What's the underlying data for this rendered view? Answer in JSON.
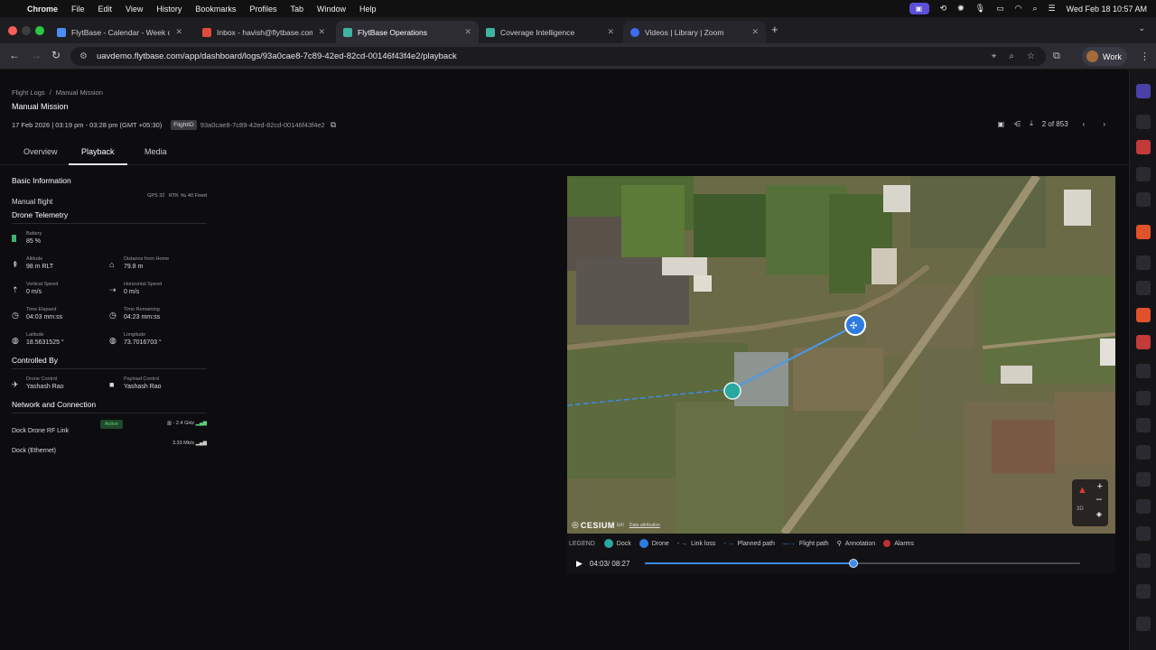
{
  "menubar": {
    "app": "Chrome",
    "items": [
      "File",
      "Edit",
      "View",
      "History",
      "Bookmarks",
      "Profiles",
      "Tab",
      "Window",
      "Help"
    ],
    "clock": "Wed Feb 18  10:57 AM"
  },
  "tabs": [
    {
      "label": "FlytBase - Calendar - Week o",
      "color": "#4a8df6"
    },
    {
      "label": "Inbox - havish@flytbase.com",
      "color": "#e04b3c"
    },
    {
      "label": "FlytBase Operations",
      "color": "#3fb3a0"
    },
    {
      "label": "Coverage Intelligence",
      "color": "#3fb3a0"
    },
    {
      "label": "Videos | Library | Zoom",
      "color": "#3c6cf0"
    }
  ],
  "address": {
    "url": "uavdemo.flytbase.com/app/dashboard/logs/93a0cae8-7c89-42ed-82cd-00146f43f4e2/playback",
    "profile": "Work"
  },
  "page": {
    "breadcrumb": [
      "Flight Logs",
      "Manual Mission"
    ],
    "title": "Manual Mission",
    "datetime": "17 Feb 2026 | 03:19 pm - 03:28 pm (GMT +05:30)",
    "flight_id_label": "FlightID",
    "flight_id": "93a0cae8-7c89-42ed-82cd-00146f43f4e2",
    "pager": "2 of 853",
    "tabs": [
      "Overview",
      "Playback",
      "Media"
    ]
  },
  "panel": {
    "basic_title": "Basic Information",
    "flight_type": "Manual flight",
    "gps": "GPS 32",
    "rtk": "RTK",
    "rtk_status": "40 Fixed",
    "telemetry_title": "Drone Telemetry",
    "battery": {
      "label": "Battery",
      "value": "85 %"
    },
    "altitude": {
      "label": "Altitude",
      "value": "98 m RLT"
    },
    "distance": {
      "label": "Distance from Home",
      "value": "79.8 m"
    },
    "vspeed": {
      "label": "Vertical Speed",
      "value": "0 m/s"
    },
    "hspeed": {
      "label": "Horizontal Speed",
      "value": "0 m/s"
    },
    "elapsed": {
      "label": "Time Elapsed",
      "value": "04:03 mm:ss"
    },
    "remaining": {
      "label": "Time Remaining",
      "value": "04:23 mm:ss"
    },
    "latitude": {
      "label": "Latitude",
      "value": "18.5631525 °"
    },
    "longitude": {
      "label": "Longitude",
      "value": "73.7016703 °"
    },
    "controlled_title": "Controlled By",
    "drone_control": {
      "label": "Drone Control",
      "value": "Yashash Rao"
    },
    "payload_control": {
      "label": "Payload Control",
      "value": "Yashash Rao"
    },
    "network_title": "Network and Connection",
    "rf_link": {
      "label": "Dock Drone RF Link",
      "status": "Active",
      "value": "- 2.4 GHz"
    },
    "ethernet": {
      "label": "Dock (Ethernet)",
      "value": "3.33 Mb/s"
    }
  },
  "map": {
    "attribution": "Data attribution",
    "brand": "CESIUM",
    "brand_sub": "ion",
    "mode": "3D"
  },
  "legend": {
    "title": "LEGEND",
    "items": [
      "Dock",
      "Drone",
      "Link loss",
      "Planned path",
      "Flight path",
      "Annotation",
      "Alarms"
    ]
  },
  "player": {
    "time": "04:03/ 08:27",
    "progress": 0.48
  }
}
